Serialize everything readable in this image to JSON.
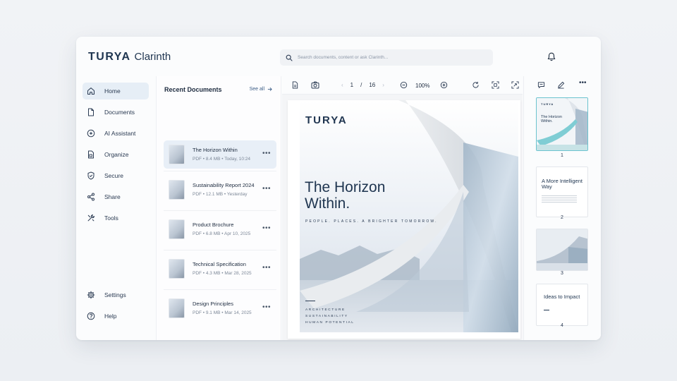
{
  "app": {
    "brand": "TURYA",
    "product": "Clarinth"
  },
  "search": {
    "placeholder": "Search documents, content or ask Clarinth..."
  },
  "sidebar": {
    "items": [
      {
        "label": "Home",
        "icon": "home-icon",
        "active": true
      },
      {
        "label": "Documents",
        "icon": "document-icon"
      },
      {
        "label": "AI Assistant",
        "icon": "ai-sparkle-icon"
      },
      {
        "label": "Organize",
        "icon": "organize-icon"
      },
      {
        "label": "Secure",
        "icon": "shield-icon"
      },
      {
        "label": "Share",
        "icon": "share-icon"
      },
      {
        "label": "Tools",
        "icon": "tools-icon"
      }
    ],
    "bottom": [
      {
        "label": "Settings",
        "icon": "gear-icon"
      },
      {
        "label": "Help",
        "icon": "help-icon"
      }
    ]
  },
  "recent": {
    "title": "Recent Documents",
    "see_all": "See all",
    "docs": [
      {
        "name": "The Horizon Within",
        "meta": "PDF • 8.4 MB • Today, 10:24",
        "active": true
      },
      {
        "name": "Sustainability Report 2024",
        "meta": "PDF • 12.1 MB • Yesterday"
      },
      {
        "name": "Product Brochure",
        "meta": "PDF • 6.8 MB • Apr 10, 2025"
      },
      {
        "name": "Technical Specification",
        "meta": "PDF • 4.3 MB • Mar 28, 2025"
      },
      {
        "name": "Design Principles",
        "meta": "PDF • 9.1 MB • Mar 14, 2025"
      }
    ]
  },
  "viewer": {
    "page_current": "1",
    "page_sep": "/",
    "page_total": "16",
    "zoom": "100%",
    "cover": {
      "brand": "TURYA",
      "title": "The Horizon Within.",
      "tagline": "PEOPLE. PLACES. A BRIGHTER TOMORROW.",
      "footer": [
        "ARCHITECTURE",
        "SUSTAINABILITY",
        "HUMAN POTENTIAL"
      ]
    }
  },
  "thumbnails": [
    {
      "num": "1",
      "brand": "TURYA",
      "title": "The Horizon Within.",
      "active": true
    },
    {
      "num": "2",
      "title": "A More Intelligent Way"
    },
    {
      "num": "3"
    },
    {
      "num": "4",
      "title": "Ideas to Impact"
    }
  ],
  "colors": {
    "accent": "#e6eef6",
    "brand": "#1f3550",
    "thumb_active": "#6cc3cf"
  }
}
